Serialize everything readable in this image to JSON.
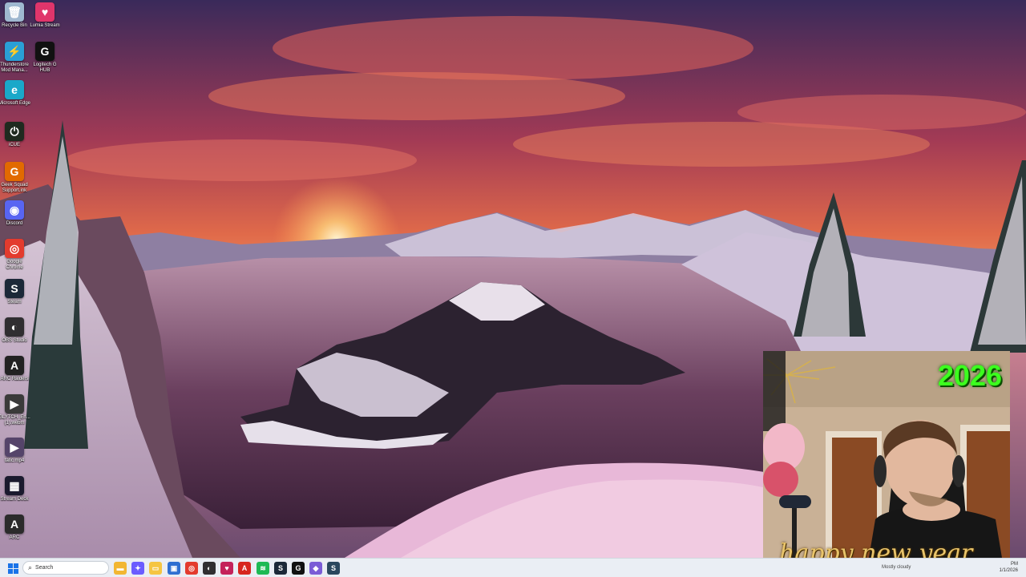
{
  "desktop_icons": [
    {
      "label": "Recycle Bin",
      "icon": "recycle-bin-icon",
      "color": "#9fb8d0",
      "glyph": "🗑"
    },
    {
      "label": "Lumia Stream",
      "icon": "lumia-stream-icon",
      "color": "#e0356b",
      "glyph": "♥"
    },
    {
      "label": "Thunderstore Mod Mana...",
      "icon": "thunderstore-icon",
      "color": "#2a9fd6",
      "glyph": "⚡"
    },
    {
      "label": "Logitech G HUB",
      "icon": "logitech-ghub-icon",
      "color": "#111111",
      "glyph": "G"
    },
    {
      "label": "Microsoft Edge",
      "icon": "edge-icon",
      "color": "#1aa8c9",
      "glyph": "e"
    },
    {
      "label": "iCUE",
      "icon": "icue-icon",
      "color": "#1f2a1f",
      "glyph": "⏻"
    },
    {
      "label": "Geek Squad Support.ink",
      "icon": "geek-squad-icon",
      "color": "#e26a00",
      "glyph": "G"
    },
    {
      "label": "Discord",
      "icon": "discord-icon",
      "color": "#5865f2",
      "glyph": "◉"
    },
    {
      "label": "Google Chrome",
      "icon": "chrome-icon",
      "color": "#e33b2e",
      "glyph": "◎"
    },
    {
      "label": "Steam",
      "icon": "steam-icon",
      "color": "#1b2838",
      "glyph": "S"
    },
    {
      "label": "OBS Studio",
      "icon": "obs-icon",
      "color": "#302e31",
      "glyph": "◐"
    },
    {
      "label": "ARC Raiders",
      "icon": "arc-raiders-icon",
      "color": "#222222",
      "glyph": "A"
    },
    {
      "label": "GLYTCH_En... (1).webm",
      "icon": "video-file-icon",
      "color": "#3a3a3a",
      "glyph": "▶"
    },
    {
      "label": "tatic.mp4",
      "icon": "video-file-icon",
      "color": "#55446a",
      "glyph": "▶"
    },
    {
      "label": "Stream Deck",
      "icon": "stream-deck-icon",
      "color": "#1a1a2e",
      "glyph": "▦"
    },
    {
      "label": "ARC",
      "icon": "arc-icon",
      "color": "#2b2b2b",
      "glyph": "A"
    }
  ],
  "webcam": {
    "year_text": "2026",
    "caption": "happy new year"
  },
  "taskbar": {
    "search_placeholder": "Search",
    "apps": [
      {
        "name": "file-explorer",
        "icon": "file-explorer-icon",
        "color": "#f2b632",
        "glyph": "▬"
      },
      {
        "name": "copilot",
        "icon": "copilot-icon",
        "color": "#6a5cff",
        "glyph": "✦"
      },
      {
        "name": "folder",
        "icon": "folder-icon",
        "color": "#f5c542",
        "glyph": "▭"
      },
      {
        "name": "store",
        "icon": "store-icon",
        "color": "#2f6fd1",
        "glyph": "▣"
      },
      {
        "name": "chrome",
        "icon": "chrome-icon",
        "color": "#e33b2e",
        "glyph": "◎"
      },
      {
        "name": "obs",
        "icon": "obs-icon",
        "color": "#302e31",
        "glyph": "◐"
      },
      {
        "name": "lumia",
        "icon": "lumia-stream-icon",
        "color": "#c4225a",
        "glyph": "♥"
      },
      {
        "name": "adobe",
        "icon": "adobe-icon",
        "color": "#d7261e",
        "glyph": "A"
      },
      {
        "name": "spotify",
        "icon": "spotify-icon",
        "color": "#1db954",
        "glyph": "≋"
      },
      {
        "name": "steam",
        "icon": "steam-icon",
        "color": "#1b2838",
        "glyph": "S"
      },
      {
        "name": "logitech",
        "icon": "logitech-ghub-icon",
        "color": "#111111",
        "glyph": "G"
      },
      {
        "name": "streamlabs",
        "icon": "streamlabs-icon",
        "color": "#7b5cd6",
        "glyph": "◆"
      },
      {
        "name": "steam-2",
        "icon": "steam-icon",
        "color": "#2a475e",
        "glyph": "S"
      }
    ],
    "weather_text": "Mostly cloudy",
    "clock_time": "PM",
    "clock_date": "1/1/2026"
  }
}
